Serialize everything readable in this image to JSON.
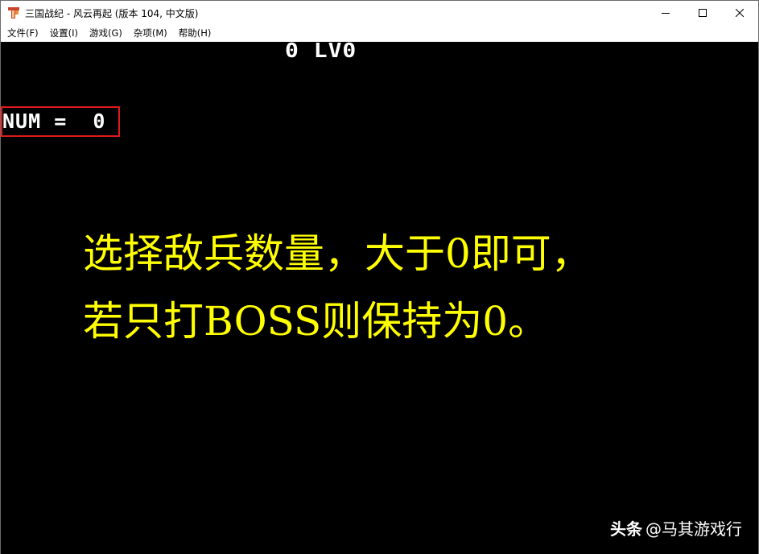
{
  "window": {
    "title": "三国战纪 - 风云再起 (版本 104, 中文版)",
    "icon": "app-logo-icon",
    "controls": [
      "minimize-icon",
      "maximize-icon",
      "close-icon"
    ]
  },
  "menu": {
    "items": [
      {
        "label": "文件(F)"
      },
      {
        "label": "设置(I)"
      },
      {
        "label": "游戏(G)"
      },
      {
        "label": "杂项(M)"
      },
      {
        "label": "帮助(H)"
      }
    ]
  },
  "game": {
    "level_text": "0 LV0",
    "num_text": "NUM =  0",
    "highlight_color": "#e01a1a",
    "caption_color": "#ffff00",
    "caption_line1": "选择敌兵数量，大于0即可，",
    "caption_line2": "若只打BOSS则保持为0。"
  },
  "watermark": {
    "brand": "头条",
    "handle": "@马其游戏行"
  }
}
